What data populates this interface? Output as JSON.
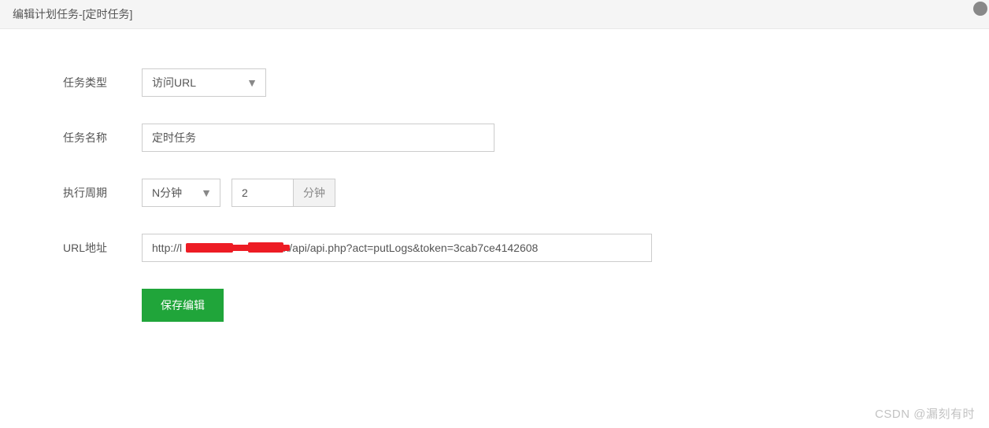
{
  "header": {
    "title": "编辑计划任务-[定时任务]"
  },
  "form": {
    "taskType": {
      "label": "任务类型",
      "value": "访问URL"
    },
    "taskName": {
      "label": "任务名称",
      "value": "定时任务"
    },
    "period": {
      "label": "执行周期",
      "unitSelect": "N分钟",
      "value": "2",
      "unitSuffix": "分钟"
    },
    "url": {
      "label": "URL地址",
      "value": "http://l                            sron/api/api.php?act=putLogs&token=3cab7ce4142608"
    },
    "save": {
      "label": "保存编辑"
    }
  },
  "watermark": "CSDN @漏刻有时"
}
